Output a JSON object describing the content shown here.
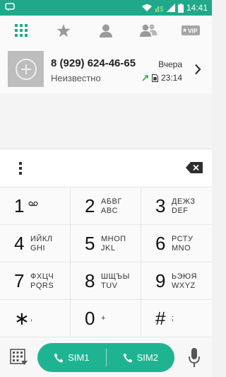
{
  "status_bar": {
    "time": "14:41",
    "icons": [
      "message-icon",
      "wifi-icon",
      "signal-icon",
      "sim-signal-icon",
      "battery-icon"
    ]
  },
  "tabs": [
    {
      "name": "keypad-tab",
      "icon": "dialpad-grid-icon",
      "active": true
    },
    {
      "name": "favorites-tab",
      "icon": "star-icon",
      "active": false
    },
    {
      "name": "contacts-tab",
      "icon": "person-icon",
      "active": false
    },
    {
      "name": "groups-tab",
      "icon": "group-icon",
      "active": false
    },
    {
      "name": "vip-tab",
      "icon": "vip-icon",
      "label": "VIP",
      "active": false
    }
  ],
  "call_log": [
    {
      "number": "8 (929) 624-46-65",
      "name": "Неизвестно",
      "date": "Вчера",
      "time": "23:14",
      "call_type_icon": "outgoing-call-arrow-icon",
      "sim_icon": "sim-card-icon"
    }
  ],
  "keypad": [
    {
      "digit": "1",
      "line1": "",
      "line2": "",
      "extra_icon": "voicemail-icon"
    },
    {
      "digit": "2",
      "line1": "АБВГ",
      "line2": "ABC"
    },
    {
      "digit": "3",
      "line1": "ДЕЖЗ",
      "line2": "DEF"
    },
    {
      "digit": "4",
      "line1": "ИЙКЛ",
      "line2": "GHI"
    },
    {
      "digit": "5",
      "line1": "МНОП",
      "line2": "JKL"
    },
    {
      "digit": "6",
      "line1": "РСТУ",
      "line2": "MNO"
    },
    {
      "digit": "7",
      "line1": "ФХЦЧ",
      "line2": "PQRS"
    },
    {
      "digit": "8",
      "line1": "ШЩЪЫ",
      "line2": "TUV"
    },
    {
      "digit": "9",
      "line1": "ЬЭЮЯ",
      "line2": "WXYZ"
    },
    {
      "digit": "∗",
      "mid": ","
    },
    {
      "digit": "0",
      "mid": "+"
    },
    {
      "digit": "#",
      "mid": ";"
    }
  ],
  "bottom_bar": {
    "sim1_label": "SIM1",
    "sim2_label": "SIM2"
  },
  "colors": {
    "accent": "#1fa98a",
    "call_button": "#1fb491",
    "outgoing_arrow": "#3cb043"
  }
}
